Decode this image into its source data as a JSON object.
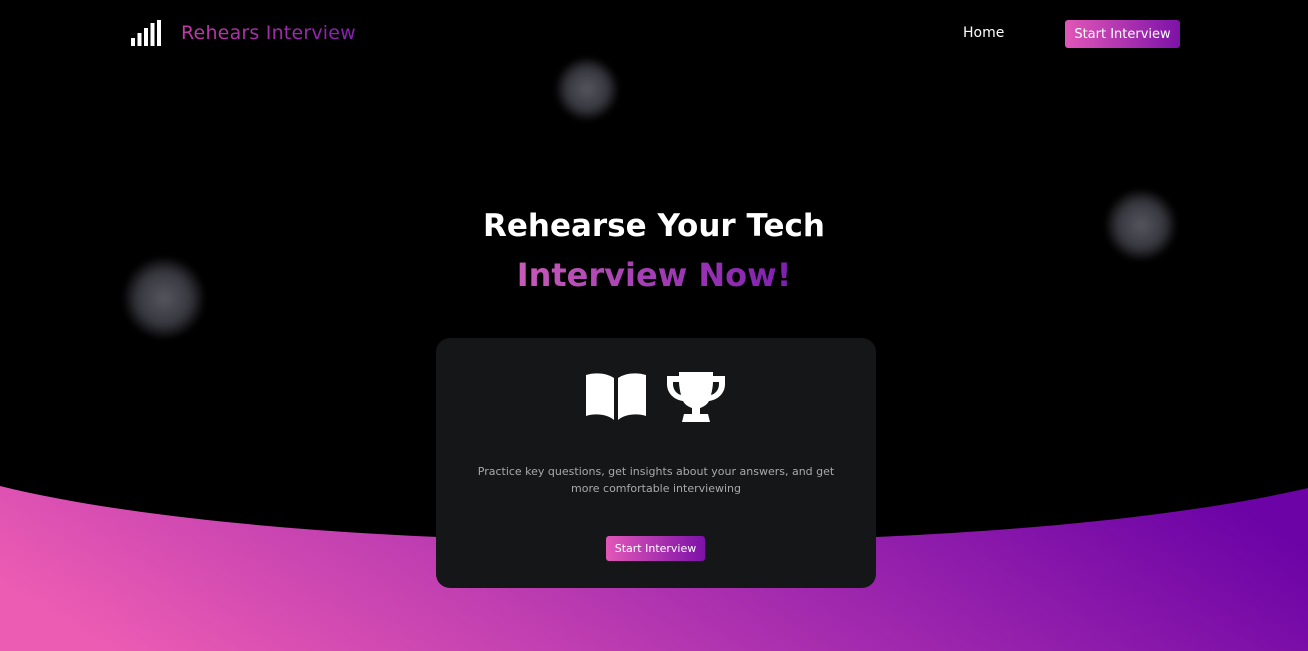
{
  "nav": {
    "brand_name": "Rehears Interview",
    "brand_icon": "signal-bars-icon",
    "home_label": "Home",
    "cta_label": "Start Interview"
  },
  "hero": {
    "line1": "Rehearse Your Tech",
    "line2": "Interview Now!"
  },
  "card": {
    "icons": [
      "book-open-icon",
      "trophy-icon"
    ],
    "description": "Practice key questions, get insights about your answers, and get more comfortable interviewing",
    "cta_label": "Start Interview"
  },
  "colors": {
    "background": "#000000",
    "accent_start": "#e257b8",
    "accent_end": "#7c12a8",
    "card_bg": "#151618"
  }
}
